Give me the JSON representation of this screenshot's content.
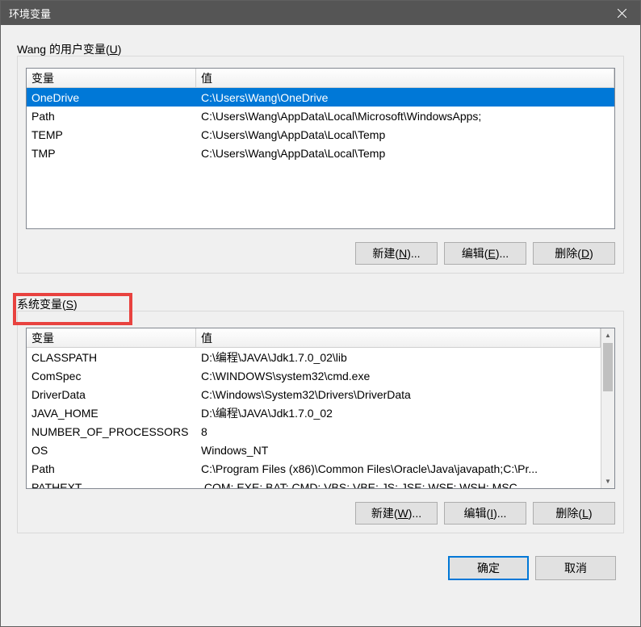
{
  "window": {
    "title": "环境变量"
  },
  "user_section": {
    "label_prefix": "Wang 的用户变量(",
    "label_key": "U",
    "label_suffix": ")",
    "headers": {
      "name": "变量",
      "value": "值"
    },
    "rows": [
      {
        "name": "OneDrive",
        "value": "C:\\Users\\Wang\\OneDrive",
        "selected": true
      },
      {
        "name": "Path",
        "value": "C:\\Users\\Wang\\AppData\\Local\\Microsoft\\WindowsApps;",
        "selected": false
      },
      {
        "name": "TEMP",
        "value": "C:\\Users\\Wang\\AppData\\Local\\Temp",
        "selected": false
      },
      {
        "name": "TMP",
        "value": "C:\\Users\\Wang\\AppData\\Local\\Temp",
        "selected": false
      }
    ],
    "buttons": {
      "new_label": "新建(",
      "new_key": "N",
      "new_suffix": ")...",
      "edit_label": "编辑(",
      "edit_key": "E",
      "edit_suffix": ")...",
      "delete_label": "删除(",
      "delete_key": "D",
      "delete_suffix": ")"
    }
  },
  "system_section": {
    "label_prefix": "系统变量(",
    "label_key": "S",
    "label_suffix": ")",
    "headers": {
      "name": "变量",
      "value": "值"
    },
    "rows": [
      {
        "name": "CLASSPATH",
        "value": "D:\\编程\\JAVA\\Jdk1.7.0_02\\lib"
      },
      {
        "name": "ComSpec",
        "value": "C:\\WINDOWS\\system32\\cmd.exe"
      },
      {
        "name": "DriverData",
        "value": "C:\\Windows\\System32\\Drivers\\DriverData"
      },
      {
        "name": "JAVA_HOME",
        "value": "D:\\编程\\JAVA\\Jdk1.7.0_02"
      },
      {
        "name": "NUMBER_OF_PROCESSORS",
        "value": "8"
      },
      {
        "name": "OS",
        "value": "Windows_NT"
      },
      {
        "name": "Path",
        "value": "C:\\Program Files (x86)\\Common Files\\Oracle\\Java\\javapath;C:\\Pr..."
      },
      {
        "name": "PATHEXT",
        "value": ".COM;.EXE;.BAT;.CMD;.VBS;.VBE;.JS;.JSE;.WSF;.WSH;.MSC"
      }
    ],
    "buttons": {
      "new_label": "新建(",
      "new_key": "W",
      "new_suffix": ")...",
      "edit_label": "编辑(",
      "edit_key": "I",
      "edit_suffix": ")...",
      "delete_label": "删除(",
      "delete_key": "L",
      "delete_suffix": ")"
    }
  },
  "bottom": {
    "ok": "确定",
    "cancel": "取消"
  }
}
